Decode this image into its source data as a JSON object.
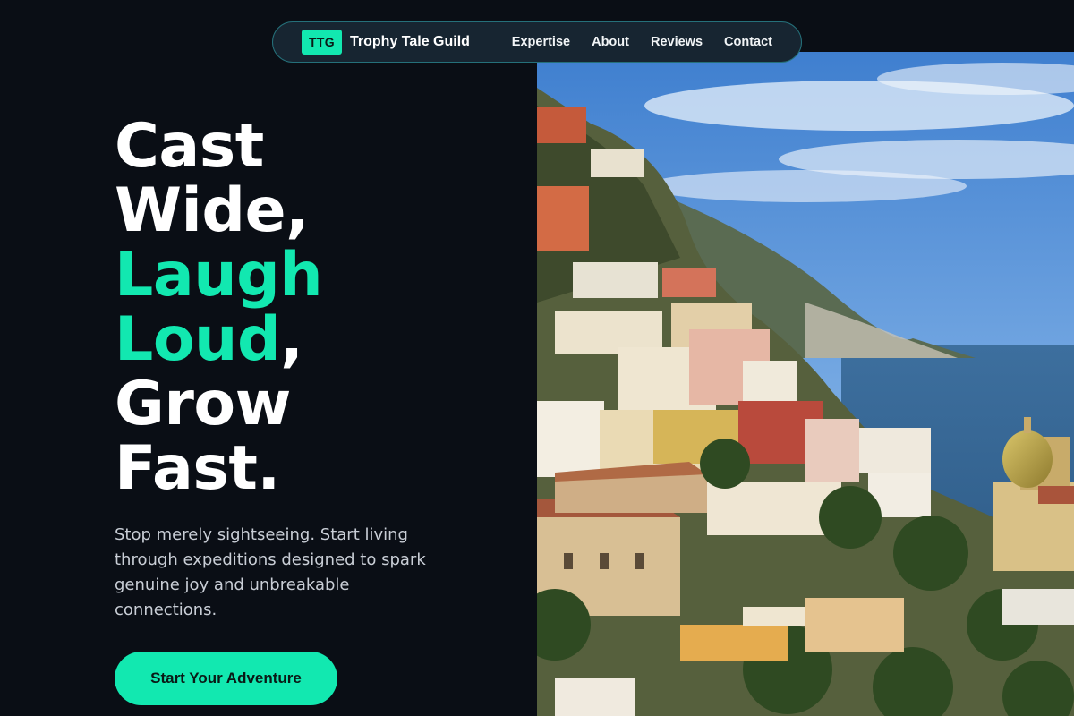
{
  "brand": {
    "badge": "TTG",
    "name": "Trophy Tale Guild"
  },
  "nav": {
    "links": [
      "Expertise",
      "About",
      "Reviews",
      "Contact"
    ]
  },
  "hero": {
    "headline": {
      "line1": "Cast",
      "line2": "Wide,",
      "line3": "Laugh",
      "line4_accent": "Loud",
      "line4_rest": ",",
      "line5": "Grow",
      "line6": "Fast."
    },
    "lede": "Stop merely sightseeing. Start living through expeditions designed to spark genuine joy and unbreakable connections.",
    "cta_label": "Start Your Adventure",
    "image_alt": "Positano cliffside village over the sea"
  },
  "colors": {
    "accent": "#12e8b0",
    "background": "#0a0e15",
    "nav_bg": "#172531",
    "nav_border": "#25707a"
  }
}
